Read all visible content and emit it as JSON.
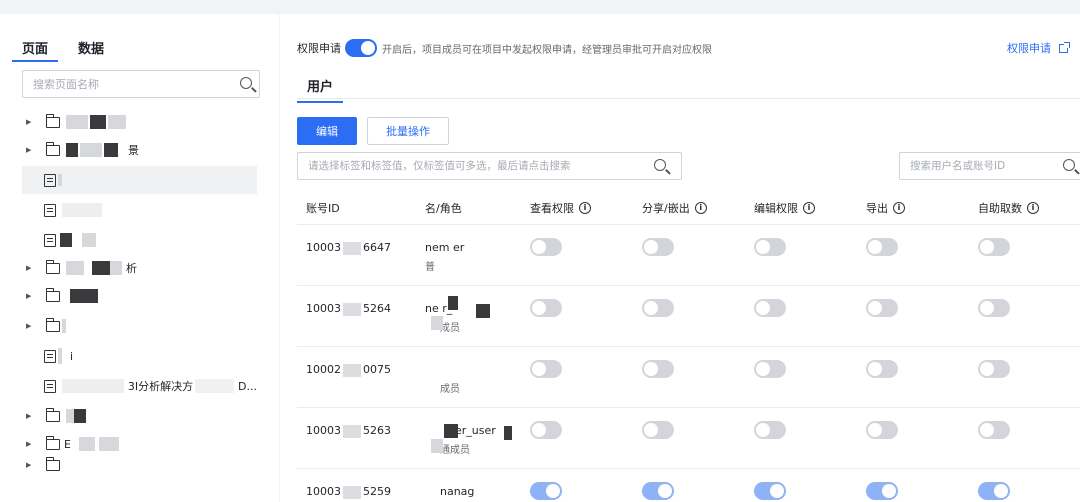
{
  "left": {
    "tabs": [
      {
        "label": "页面",
        "active": true
      },
      {
        "label": "数据",
        "active": false
      }
    ],
    "search_placeholder": "搜索页面名称",
    "tree": [
      {
        "type": "folder",
        "expandable": true,
        "name": ""
      },
      {
        "type": "folder",
        "expandable": true,
        "name": "景"
      },
      {
        "type": "page",
        "expandable": false,
        "name": "",
        "selected": true
      },
      {
        "type": "page",
        "expandable": false,
        "name": ""
      },
      {
        "type": "page",
        "expandable": false,
        "name": ""
      },
      {
        "type": "folder",
        "expandable": true,
        "name": "析"
      },
      {
        "type": "folder",
        "expandable": true,
        "name": ""
      },
      {
        "type": "folder",
        "expandable": true,
        "name": ""
      },
      {
        "type": "page",
        "expandable": false,
        "name": "i"
      },
      {
        "type": "page",
        "expandable": false,
        "name": "3I分析解决方",
        "suffix": "D..."
      },
      {
        "type": "folder",
        "expandable": true,
        "name": ""
      },
      {
        "type": "folder",
        "expandable": true,
        "name": "E"
      }
    ]
  },
  "right": {
    "permission": {
      "label": "权限申请",
      "enabled": true,
      "description": "开启后，项目成员可在项目中发起权限申请，经管理员审批可开启对应权限",
      "link_label": "权限申请"
    },
    "tab_label": "用户",
    "buttons": {
      "edit": "编辑",
      "batch": "批量操作"
    },
    "tag_search_placeholder": "请选择标签和标签值，仅标签值可多选，最后请点击搜索",
    "user_search_placeholder": "搜索用户名或账号ID",
    "columns": [
      "账号ID",
      "名/角色",
      "查看权限",
      "分享/嵌出",
      "编辑权限",
      "导出",
      "自助取数"
    ],
    "rows": [
      {
        "id_prefix": "10003",
        "id_suffix": "6647",
        "user": "nem er",
        "role": "普",
        "perms": [
          false,
          false,
          false,
          false,
          false
        ]
      },
      {
        "id_prefix": "10003",
        "id_suffix": "5264",
        "user": "ne r_",
        "role": "成员",
        "perms": [
          false,
          false,
          false,
          false,
          false
        ]
      },
      {
        "id_prefix": "10002",
        "id_suffix": "0075",
        "user": "",
        "role": "成员",
        "perms": [
          false,
          false,
          false,
          false,
          false
        ]
      },
      {
        "id_prefix": "10003",
        "id_suffix": "5263",
        "user": "er_user",
        "role": "通成员",
        "perms": [
          false,
          false,
          false,
          false,
          false
        ]
      },
      {
        "id_prefix": "10003",
        "id_suffix": "5259",
        "user": "nanag",
        "role": "",
        "perms": [
          true,
          true,
          true,
          true,
          true
        ]
      }
    ]
  },
  "colors": {
    "accent": "#2b6ef5",
    "switch_off": "#d3d5da",
    "switch_on_disabled": "#8fb2f6"
  }
}
